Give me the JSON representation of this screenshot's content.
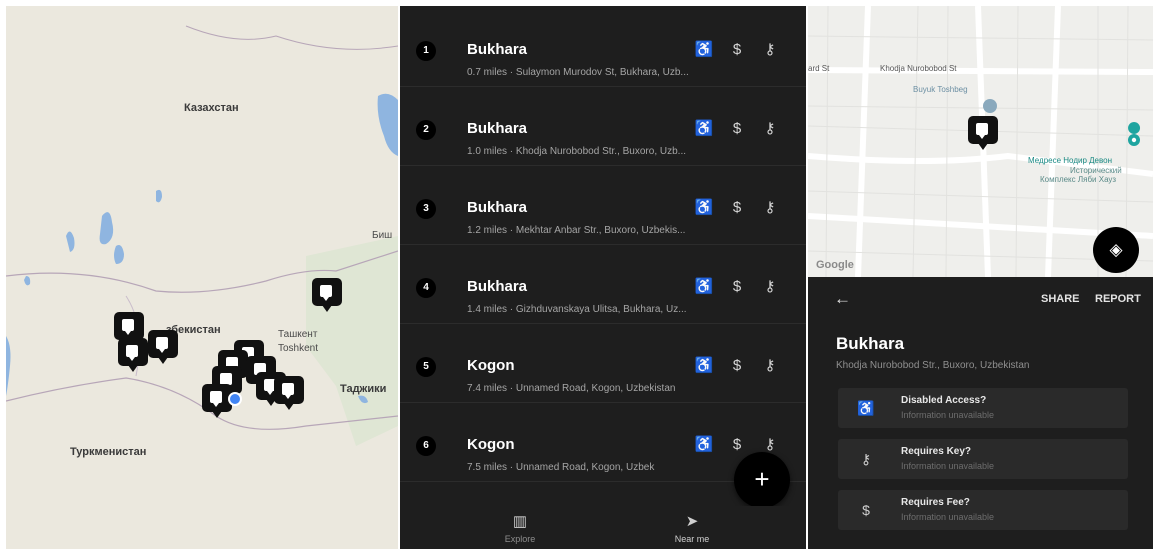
{
  "map": {
    "labels": {
      "kazakhstan": "Казахстан",
      "uzbekistan": "збекистан",
      "turkmenistan": "Туркменистан",
      "tajikistan": "Таджики",
      "tashkent_cyr": "Ташкент",
      "tashkent_lat": "Toshkent",
      "bish": "Биш"
    }
  },
  "list": {
    "items": [
      {
        "num": "1",
        "title": "Bukhara",
        "subtitle": "0.7 miles · Sulaymon Murodov St, Bukhara, Uzb..."
      },
      {
        "num": "2",
        "title": "Bukhara",
        "subtitle": "1.0 miles · Khodja Nurobobod Str., Buxoro, Uzb..."
      },
      {
        "num": "3",
        "title": "Bukhara",
        "subtitle": "1.2 miles · Mekhtar Anbar Str., Buxoro, Uzbekis..."
      },
      {
        "num": "4",
        "title": "Bukhara",
        "subtitle": "1.4 miles · Gizhduvanskaya Ulitsa, Bukhara, Uz..."
      },
      {
        "num": "5",
        "title": "Kogon",
        "subtitle": "7.4 miles · Unnamed Road, Kogon, Uzbekistan"
      },
      {
        "num": "6",
        "title": "Kogon",
        "subtitle": "7.5 miles · Unnamed Road, Kogon, Uzbek"
      }
    ],
    "icons": {
      "accessible": "accessible-icon",
      "fee": "dollar-icon",
      "key": "key-icon"
    },
    "fab_label": "+",
    "nav": {
      "explore": "Explore",
      "near_me": "Near me"
    }
  },
  "detail": {
    "map": {
      "street_left": "ard St",
      "street_top": "Khodja Nurobobod St",
      "poi": "Buyuk Toshbeg",
      "teal_poi_1": "Медресе Нодир Девон",
      "teal_poi_2": "Исторический",
      "teal_poi_3": "Комплекс Ляби Хауз",
      "google": "Google"
    },
    "share": "SHARE",
    "report": "REPORT",
    "title": "Bukhara",
    "subtitle": "Khodja Nurobobod Str., Buxoro, Uzbekistan",
    "features": [
      {
        "title": "Disabled Access?",
        "sub": "Information unavailable",
        "icon": "accessible-icon"
      },
      {
        "title": "Requires Key?",
        "sub": "Information unavailable",
        "icon": "key-icon"
      },
      {
        "title": "Requires Fee?",
        "sub": "Information unavailable",
        "icon": "dollar-icon"
      }
    ]
  },
  "colors": {
    "dark_bg": "#1e1e1e",
    "map_land": "#e9e6dc",
    "water": "#8fb5e0",
    "user_dot": "#4285f4"
  }
}
